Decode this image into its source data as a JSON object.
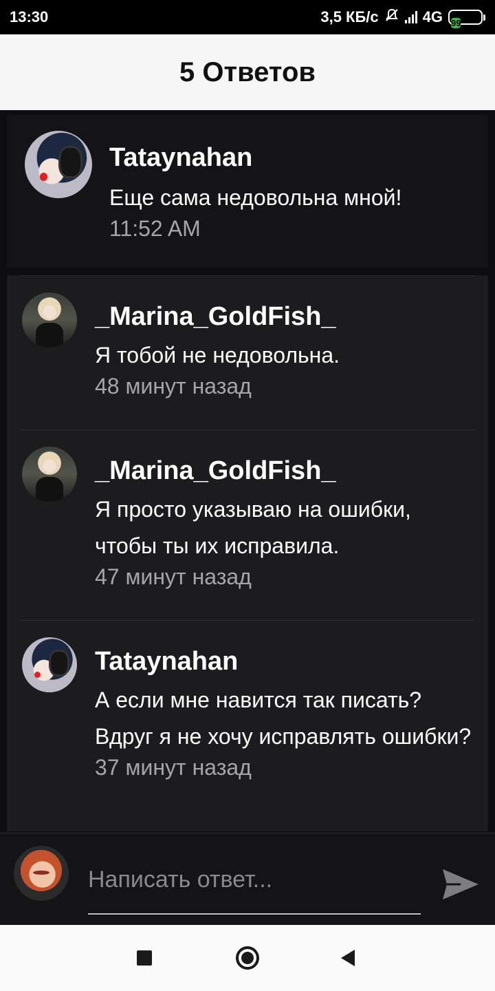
{
  "status_bar": {
    "time": "13:30",
    "net_speed": "3,5 КБ/с",
    "network": "4G",
    "battery": "99",
    "battery_level_percent": 99
  },
  "header": {
    "title": "5 Ответов"
  },
  "original_comment": {
    "author": "Tataynahan",
    "text": "Еще сама недовольна мной!",
    "time": "11:52 AM"
  },
  "replies": [
    {
      "author": "_Marina_GoldFish_",
      "text": "Я тобой не недовольна.",
      "time": "48 минут назад"
    },
    {
      "author": "_Marina_GoldFish_",
      "text": "Я просто указываю на ошибки, чтобы ты их исправила.",
      "time": "47 минут назад"
    },
    {
      "author": "Tataynahan",
      "text": "А если мне навится так писать? Вдруг я не хочу исправлять ошибки?",
      "time": "37 минут назад"
    }
  ],
  "reply_input": {
    "placeholder": "Написать ответ..."
  },
  "icons": {
    "send": "send-icon",
    "mute": "bell-off-icon",
    "signal": "signal-icon",
    "battery": "battery-icon"
  },
  "colors": {
    "background": "#0e0d10",
    "card": "#141316",
    "reply_list": "#1c1b1e",
    "header": "#f7f7f8",
    "battery": "#4caf50",
    "muted_text": "#a6a6a8"
  }
}
